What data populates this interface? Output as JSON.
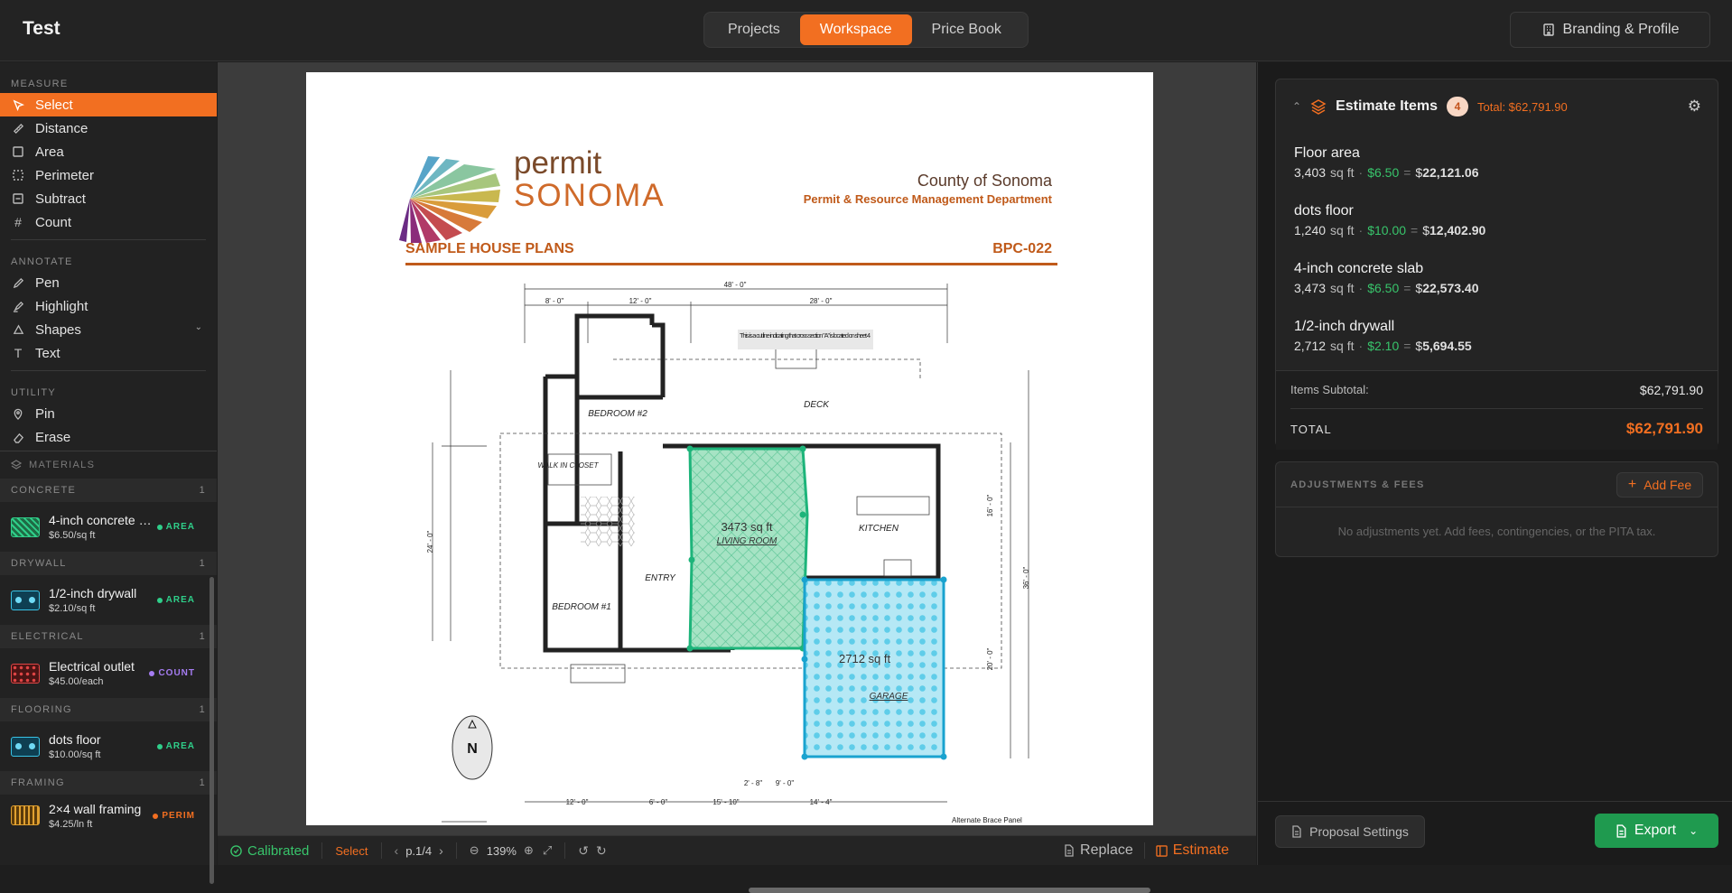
{
  "app": {
    "title": "Test"
  },
  "nav": {
    "tabs": [
      {
        "label": "Projects"
      },
      {
        "label": "Workspace"
      },
      {
        "label": "Price Book"
      }
    ],
    "branding_label": "Branding & Profile"
  },
  "sidebar": {
    "measure_label": "MEASURE",
    "measure_tools": [
      {
        "label": "Select",
        "icon": "cursor-icon"
      },
      {
        "label": "Distance",
        "icon": "ruler-icon"
      },
      {
        "label": "Area",
        "icon": "square-icon"
      },
      {
        "label": "Perimeter",
        "icon": "dashed-square-icon"
      },
      {
        "label": "Subtract",
        "icon": "minus-square-icon"
      },
      {
        "label": "Count",
        "icon": "hash-icon"
      }
    ],
    "annotate_label": "ANNOTATE",
    "annotate_tools": [
      {
        "label": "Pen",
        "icon": "pen-icon"
      },
      {
        "label": "Highlight",
        "icon": "highlighter-icon"
      },
      {
        "label": "Shapes",
        "icon": "shapes-icon"
      },
      {
        "label": "Text",
        "icon": "text-icon"
      }
    ],
    "utility_label": "UTILITY",
    "utility_tools": [
      {
        "label": "Pin",
        "icon": "pin-icon"
      },
      {
        "label": "Erase",
        "icon": "eraser-icon"
      }
    ],
    "materials_label": "MATERIALS",
    "categories": [
      {
        "name": "CONCRETE",
        "count": "1",
        "item": {
          "name": "4-inch concrete slab",
          "price": "$6.50/sq ft",
          "badge": "AREA",
          "badge_color": "#2fcf8a"
        }
      },
      {
        "name": "DRYWALL",
        "count": "1",
        "item": {
          "name": "1/2-inch drywall",
          "price": "$2.10/sq ft",
          "badge": "AREA",
          "badge_color": "#2fcf8a"
        }
      },
      {
        "name": "ELECTRICAL",
        "count": "1",
        "item": {
          "name": "Electrical outlet",
          "price": "$45.00/each",
          "badge": "COUNT",
          "badge_color": "#a57cf2"
        }
      },
      {
        "name": "FLOORING",
        "count": "1",
        "item": {
          "name": "dots floor",
          "price": "$10.00/sq ft",
          "badge": "AREA",
          "badge_color": "#2fcf8a"
        }
      },
      {
        "name": "FRAMING",
        "count": "1",
        "item": {
          "name": "2×4 wall framing",
          "price": "$4.25/ln ft",
          "badge": "PERIM",
          "badge_color": "#f26f21"
        }
      }
    ]
  },
  "document": {
    "logo_line1": "permit",
    "logo_line2": "SONOMA",
    "county": "County of Sonoma",
    "department": "Permit & Resource Management Department",
    "plan_title": "SAMPLE HOUSE PLANS",
    "plan_code": "BPC-022",
    "living_room_area": "3473 sq ft",
    "living_room_label": "LIVING ROOM",
    "garage_area": "2712 sq ft",
    "garage_label": "GARAGE",
    "rooms": [
      "BEDROOM #2",
      "BEDROOM #1",
      "KITCHEN",
      "ENTRY",
      "DECK",
      "WALK IN CLOSET"
    ],
    "dims": [
      "48' - 0\"",
      "8' - 0\"",
      "12' - 0\"",
      "28' - 0\"",
      "24' - 0\"",
      "36' - 0\"",
      "16' - 0\"",
      "20' - 0\"",
      "12' - 0\"",
      "6' - 0\"",
      "15' - 10\"",
      "14' - 4\"",
      "9' - 0\"",
      "2' - 8\""
    ],
    "notes": [
      "This is a cut line indicating that cross section \"A\" is located on sheet 4",
      "Alternate Brace Panel"
    ],
    "compass": "N"
  },
  "bottombar": {
    "calibrated": "Calibrated",
    "mode": "Select",
    "page": "p.1/4",
    "zoom": "139%",
    "replace": "Replace",
    "estimate": "Estimate"
  },
  "estimate": {
    "title": "Estimate Items",
    "count": "4",
    "total_label": "Total: $62,791.90",
    "items": [
      {
        "name": "Floor area",
        "qty": "3,403",
        "unit": "sq ft",
        "rate": "6.50",
        "amount": "22,121.06"
      },
      {
        "name": "dots floor",
        "qty": "1,240",
        "unit": "sq ft",
        "rate": "10.00",
        "amount": "12,402.90"
      },
      {
        "name": "4-inch concrete slab",
        "qty": "3,473",
        "unit": "sq ft",
        "rate": "6.50",
        "amount": "22,573.40"
      },
      {
        "name": "1/2-inch drywall",
        "qty": "2,712",
        "unit": "sq ft",
        "rate": "2.10",
        "amount": "5,694.55"
      }
    ],
    "subtotal_label": "Items Subtotal:",
    "subtotal": "$62,791.90",
    "total_word": "TOTAL",
    "total": "$62,791.90"
  },
  "adjustments": {
    "title": "ADJUSTMENTS & FEES",
    "add_label": "Add Fee",
    "empty": "No adjustments yet. Add fees, contingencies, or the PITA tax."
  },
  "footer": {
    "proposal_label": "Proposal Settings",
    "export_label": "Export"
  },
  "colors": {
    "accent": "#f26f21",
    "green": "#38c46b",
    "teal": "#2fcf8a"
  }
}
